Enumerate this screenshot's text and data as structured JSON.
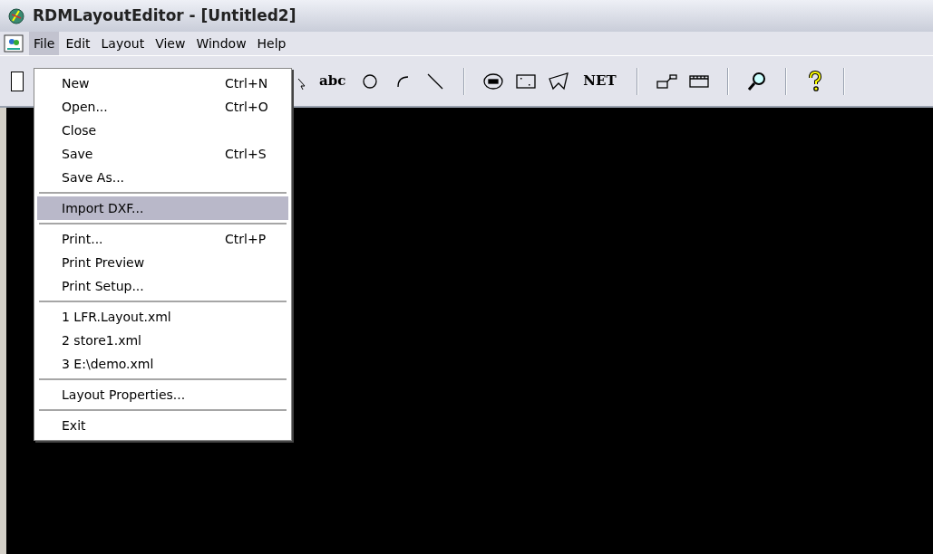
{
  "window": {
    "title": "RDMLayoutEditor - [Untitled2]"
  },
  "menu_bar": [
    {
      "label": "File",
      "selected": true
    },
    {
      "label": "Edit",
      "selected": false
    },
    {
      "label": "Layout",
      "selected": false
    },
    {
      "label": "View",
      "selected": false
    },
    {
      "label": "Window",
      "selected": false
    },
    {
      "label": "Help",
      "selected": false
    }
  ],
  "toolbar": [
    {
      "kind": "text",
      "label": "abc"
    },
    {
      "kind": "circle"
    },
    {
      "kind": "arc"
    },
    {
      "kind": "line"
    },
    {
      "kind": "separator"
    },
    {
      "kind": "ellipse"
    },
    {
      "kind": "rect"
    },
    {
      "kind": "polygon"
    },
    {
      "kind": "text",
      "label": "NET"
    },
    {
      "kind": "separator"
    },
    {
      "kind": "node"
    },
    {
      "kind": "ruler"
    },
    {
      "kind": "separator"
    },
    {
      "kind": "zoom"
    },
    {
      "kind": "separator"
    },
    {
      "kind": "help"
    },
    {
      "kind": "separator"
    }
  ],
  "file_menu": [
    {
      "kind": "item",
      "label": "New",
      "shortcut": "Ctrl+N",
      "selected": false
    },
    {
      "kind": "item",
      "label": "Open...",
      "shortcut": "Ctrl+O",
      "selected": false
    },
    {
      "kind": "item",
      "label": "Close",
      "selected": false
    },
    {
      "kind": "item",
      "label": "Save",
      "shortcut": "Ctrl+S",
      "selected": false
    },
    {
      "kind": "item",
      "label": "Save As...",
      "selected": false
    },
    {
      "kind": "separator"
    },
    {
      "kind": "item",
      "label": "Import DXF...",
      "selected": true
    },
    {
      "kind": "separator"
    },
    {
      "kind": "item",
      "label": "Print...",
      "shortcut": "Ctrl+P",
      "selected": false
    },
    {
      "kind": "item",
      "label": "Print Preview",
      "selected": false
    },
    {
      "kind": "item",
      "label": "Print Setup...",
      "selected": false
    },
    {
      "kind": "separator"
    },
    {
      "kind": "item",
      "label": "1 LFR.Layout.xml",
      "selected": false
    },
    {
      "kind": "item",
      "label": "2 store1.xml",
      "selected": false
    },
    {
      "kind": "item",
      "label": "3 E:\\demo.xml",
      "selected": false
    },
    {
      "kind": "separator"
    },
    {
      "kind": "item",
      "label": "Layout Properties...",
      "selected": false
    },
    {
      "kind": "separator"
    },
    {
      "kind": "item",
      "label": "Exit",
      "selected": false
    }
  ]
}
